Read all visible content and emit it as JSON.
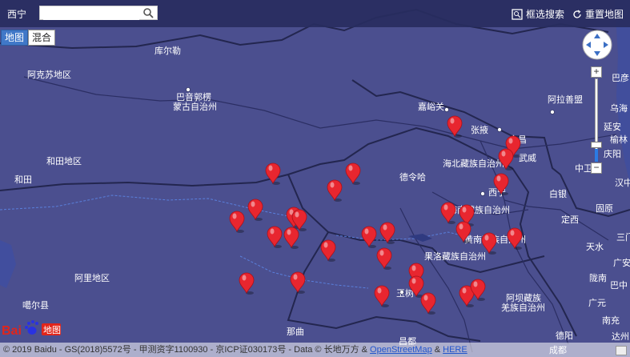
{
  "search": {
    "city": "西宁",
    "value": "",
    "placeholder": ""
  },
  "toolbar": {
    "box_search": "框选搜索",
    "reset_map": "重置地图"
  },
  "map_type": {
    "map": "地图",
    "hybrid": "混合"
  },
  "labels": {
    "kuerle": "库尔勒",
    "akesu": "阿克苏地区",
    "bayin1": "巴音郭楞",
    "bayin2": "蒙古自治州",
    "hetian_di": "和田地区",
    "hetian": "和田",
    "jiayuguan": "嘉峪关",
    "zhangye": "张掖",
    "jinchang": "金昌",
    "wuwei": "武威",
    "haibei": "海北藏族自治州",
    "delingha": "德令哈",
    "xining": "西宁",
    "hainan": "海南藏族自治州",
    "huangnan": "黄南藏族自治州",
    "guoluo": "果洛藏族自治州",
    "yushu": "玉树",
    "ali": "阿里地区",
    "gaize": "噶尔县",
    "naqu": "那曲",
    "changdu": "昌都",
    "aba1": "阿坝藏族",
    "aba2": "羌族自治州",
    "alashan": "阿拉善盟",
    "baiyin": "白银",
    "dingxi": "定西",
    "guyuan": "固原",
    "tianshui": "天水",
    "zhongwei": "中卫",
    "longnan": "陇南",
    "guangyuan": "广元",
    "deyang": "德阳",
    "chengdu": "成都",
    "nanchong": "南充",
    "bayan": "巴彦",
    "wuhai": "乌海",
    "yanan": "延安",
    "yulin": "榆林",
    "qingyang": "庆阳",
    "hanzhong": "汉中",
    "sanmenxia": "三门峡",
    "guangan": "广安",
    "bazhong": "巴中",
    "dazhou": "达州"
  },
  "markers_label": "marker",
  "copyright": {
    "text": "© 2019 Baidu - GS(2018)5572号 - 甲测资字1100930 - 京ICP证030173号 - Data © 长地万方 & ",
    "osm": "OpenStreetMap",
    "amp": " & ",
    "here": "HERE"
  },
  "logo": {
    "text": "地图"
  },
  "zoom": {
    "in": "+",
    "out": "−"
  },
  "colors": {
    "land": "#4b4f8f",
    "water": "#2f7bff",
    "marker": "#e8262f",
    "topbar": "#282c5f"
  }
}
